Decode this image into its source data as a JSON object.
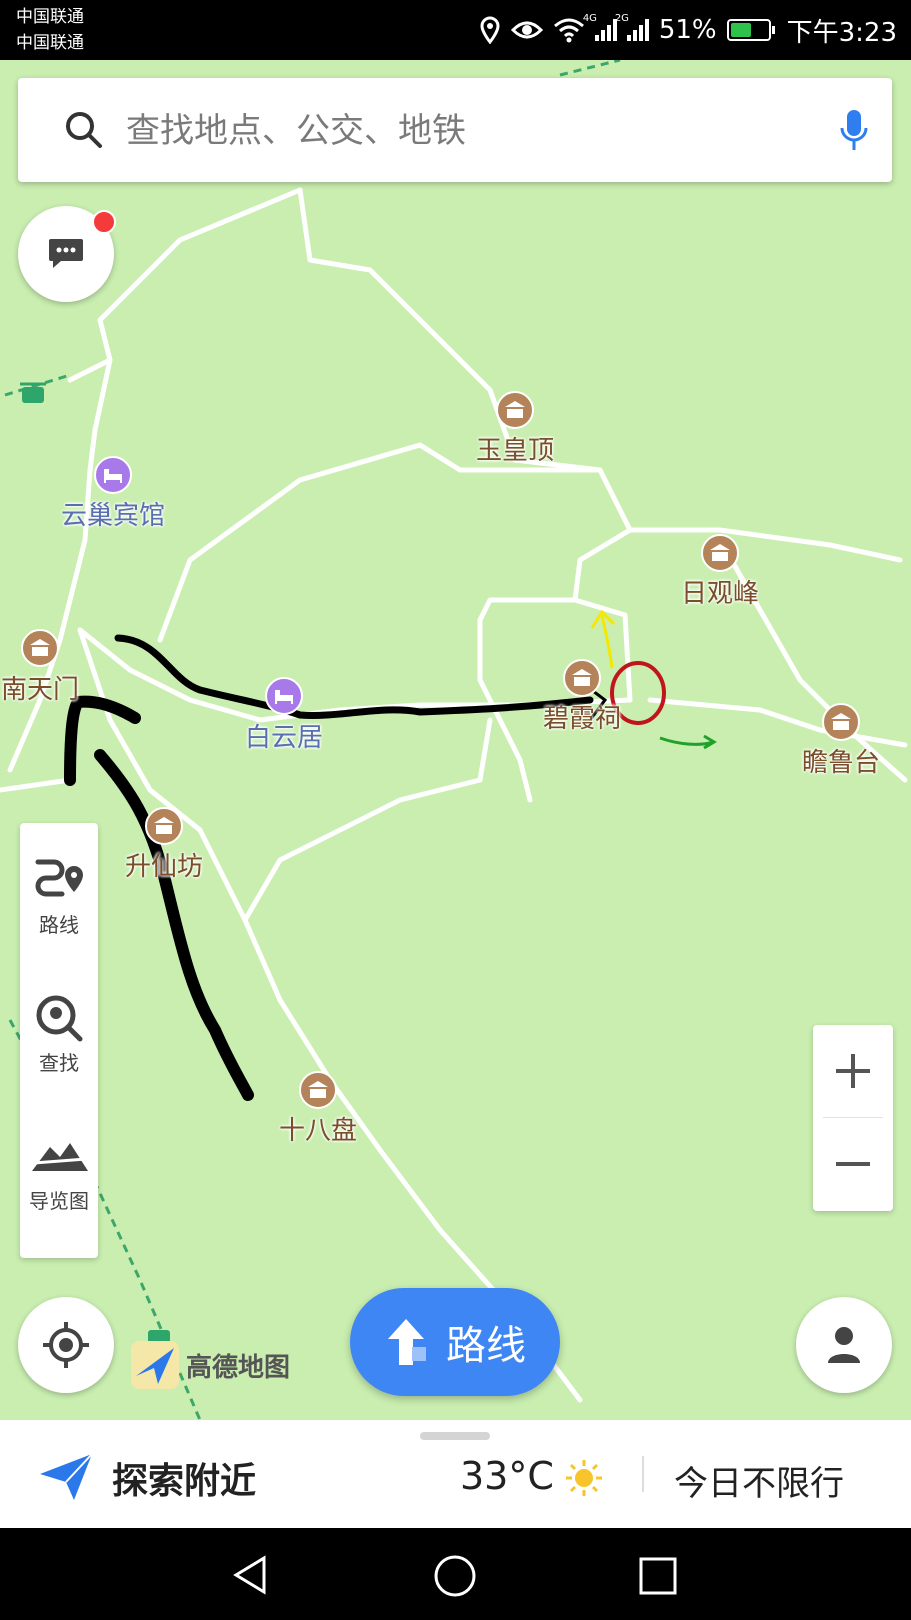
{
  "status_bar": {
    "carrier_1": "中国联通",
    "carrier_2": "中国联通",
    "network_1": "4G",
    "network_2": "2G",
    "battery": "51%",
    "time": "下午3:23",
    "icons": [
      "location-icon",
      "eye-icon",
      "wifi-icon",
      "signal-icon",
      "signal-icon",
      "battery-icon"
    ]
  },
  "search": {
    "placeholder": "查找地点、公交、地铁"
  },
  "map": {
    "pois": [
      {
        "label": "玉皇顶",
        "type": "temple"
      },
      {
        "label": "云巢宾馆",
        "type": "hotel"
      },
      {
        "label": "日观峰",
        "type": "temple"
      },
      {
        "label": "南天门",
        "type": "temple"
      },
      {
        "label": "白云居",
        "type": "hotel"
      },
      {
        "label": "碧霞祠",
        "type": "temple"
      },
      {
        "label": "瞻鲁台",
        "type": "temple"
      },
      {
        "label": "升仙坊",
        "type": "temple"
      },
      {
        "label": "十八盘",
        "type": "temple"
      }
    ],
    "annotation_colors": {
      "black": "#000000",
      "red": "#c0161b",
      "yellow": "#f5e800",
      "green": "#1fa12a"
    }
  },
  "tools": {
    "route": "路线",
    "search": "查找",
    "guide": "导览图"
  },
  "logo": {
    "name": "高德地图"
  },
  "route_button": {
    "label": "路线"
  },
  "bottom": {
    "explore": "探索附近",
    "temperature": "33°C",
    "traffic": "今日不限行"
  },
  "colors": {
    "accent": "#3f86f5",
    "map_bg": "#c9eeb0",
    "notification_dot": "#f43a3a"
  }
}
